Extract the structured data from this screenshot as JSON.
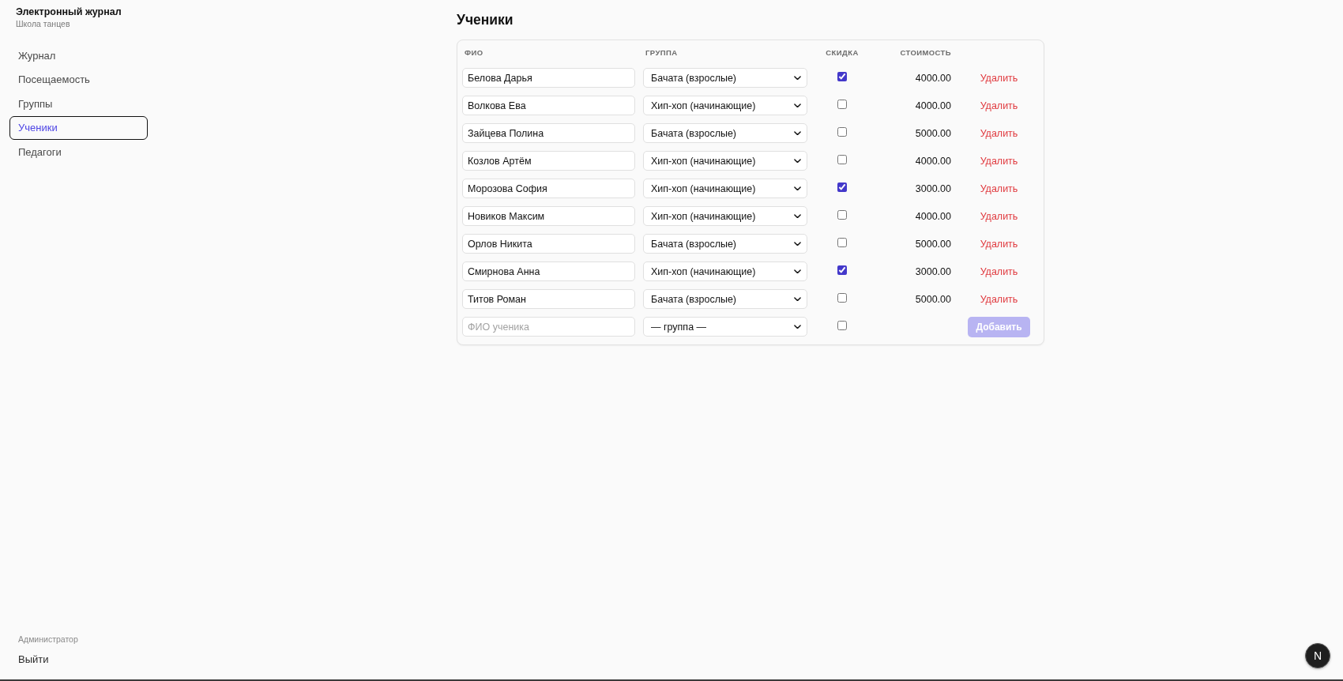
{
  "sidebar": {
    "title": "Электронный журнал",
    "subtitle": "Школа танцев",
    "items": [
      {
        "label": "Журнал",
        "selected": false
      },
      {
        "label": "Посещаемость",
        "selected": false
      },
      {
        "label": "Группы",
        "selected": false
      },
      {
        "label": "Ученики",
        "selected": true
      },
      {
        "label": "Педагоги",
        "selected": false
      }
    ],
    "user_role": "Администратор",
    "logout": "Выйти"
  },
  "page": {
    "title": "Ученики"
  },
  "table": {
    "columns": [
      "ФИО",
      "ГРУППА",
      "СКИДКА",
      "СТОИМОСТЬ"
    ],
    "rows": [
      {
        "name": "Белова Дарья",
        "group": "Бачата (взрослые)",
        "discount": true,
        "price": "4000.00",
        "action": "Удалить"
      },
      {
        "name": "Волкова Ева",
        "group": "Хип-хоп (начинающие)",
        "discount": false,
        "price": "4000.00",
        "action": "Удалить"
      },
      {
        "name": "Зайцева Полина",
        "group": "Бачата (взрослые)",
        "discount": false,
        "price": "5000.00",
        "action": "Удалить"
      },
      {
        "name": "Козлов Артём",
        "group": "Хип-хоп (начинающие)",
        "discount": false,
        "price": "4000.00",
        "action": "Удалить"
      },
      {
        "name": "Морозова София",
        "group": "Хип-хоп (начинающие)",
        "discount": true,
        "price": "3000.00",
        "action": "Удалить"
      },
      {
        "name": "Новиков Максим",
        "group": "Хип-хоп (начинающие)",
        "discount": false,
        "price": "4000.00",
        "action": "Удалить"
      },
      {
        "name": "Орлов Никита",
        "group": "Бачата (взрослые)",
        "discount": false,
        "price": "5000.00",
        "action": "Удалить"
      },
      {
        "name": "Смирнова Анна",
        "group": "Хип-хоп (начинающие)",
        "discount": true,
        "price": "3000.00",
        "action": "Удалить"
      },
      {
        "name": "Титов Роман",
        "group": "Бачата (взрослые)",
        "discount": false,
        "price": "5000.00",
        "action": "Удалить"
      }
    ],
    "new_row": {
      "name_placeholder": "ФИО ученика",
      "group": "— группа —",
      "discount": false,
      "button": {
        "label": "Добавить",
        "disabled": true
      }
    }
  },
  "dev_badge": {
    "label": "N"
  }
}
